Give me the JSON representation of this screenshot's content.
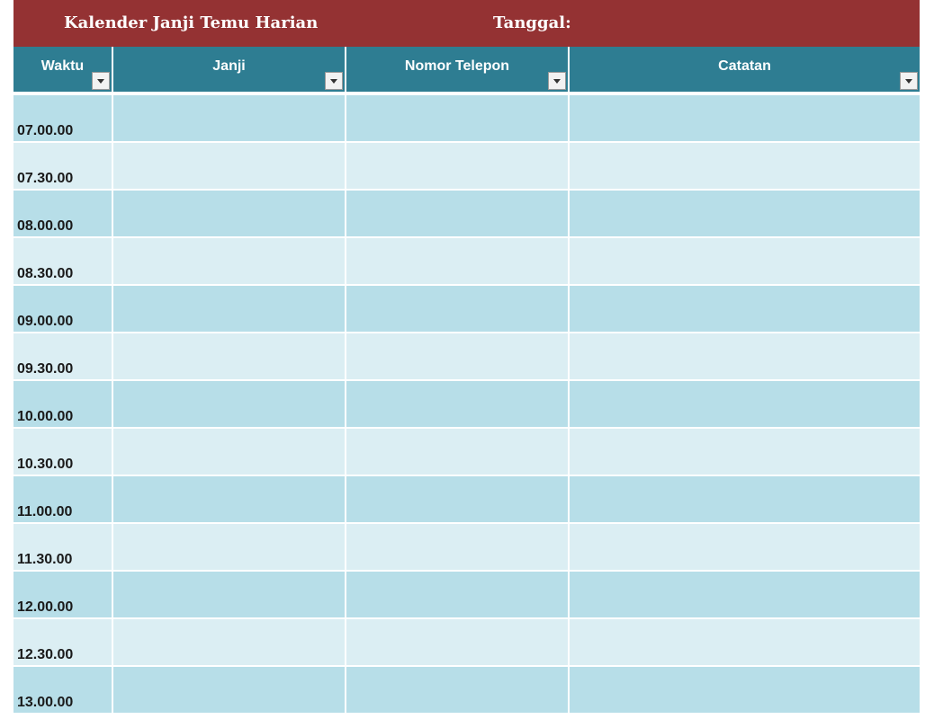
{
  "title": "Kalender Janji Temu Harian",
  "date_label": "Tanggal:",
  "columns": [
    "Waktu",
    "Janji",
    "Nomor Telepon",
    "Catatan"
  ],
  "times": [
    "07.00.00",
    "07.30.00",
    "08.00.00",
    "08.30.00",
    "09.00.00",
    "09.30.00",
    "10.00.00",
    "10.30.00",
    "11.00.00",
    "11.30.00",
    "12.00.00",
    "12.30.00",
    "13.00.00"
  ],
  "colors": {
    "title_bg": "#943233",
    "header_bg": "#2e7d92",
    "row_dark": "#b7dee8",
    "row_light": "#dbeef3"
  }
}
